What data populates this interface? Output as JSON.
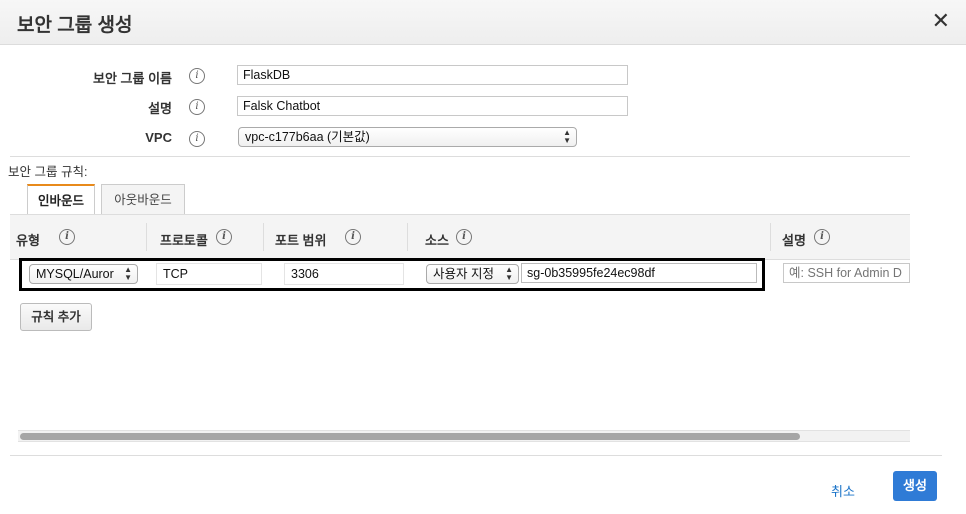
{
  "dialog": {
    "title": "보안 그룹 생성",
    "close_glyph": "✕"
  },
  "form": {
    "name_label": "보안 그룹 이름",
    "name_value": "FlaskDB",
    "desc_label": "설명",
    "desc_value": "Falsk Chatbot",
    "vpc_label": "VPC",
    "vpc_value": "vpc-c177b6aa (기본값)"
  },
  "info_glyph": "i",
  "select_glyph": "▲▼",
  "rules": {
    "section_label": "보안 그룹 규칙:",
    "tabs": [
      "인바운드",
      "아웃바운드"
    ],
    "active_tab": "인바운드",
    "columns": [
      "유형",
      "프로토콜",
      "포트 범위",
      "소스",
      "설명"
    ],
    "row": {
      "type": "MYSQL/Auror",
      "protocol": "TCP",
      "port": "3306",
      "source_type": "사용자 지정",
      "source_value": "sg-0b35995fe24ec98df",
      "description_placeholder": "예: SSH for Admin D"
    },
    "add_rule_label": "규칙 추가"
  },
  "footer": {
    "cancel_label": "취소",
    "create_label": "생성"
  },
  "colors": {
    "accent": "#2f7bd6",
    "tab_active_border": "#e88a1b",
    "link": "#1a73c8"
  }
}
